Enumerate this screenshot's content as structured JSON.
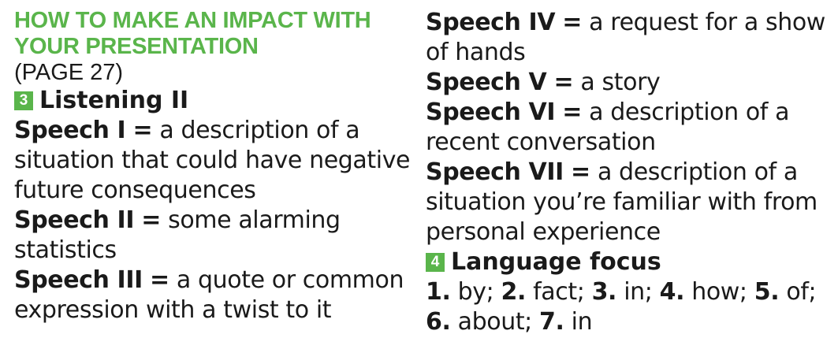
{
  "header": {
    "title": "HOW TO MAKE AN IMPACT WITH YOUR PRESENTATION",
    "page_ref": "(PAGE 27)"
  },
  "sections": {
    "listening": {
      "number": "3",
      "title": "Listening II"
    },
    "language": {
      "number": "4",
      "title": "Language focus"
    }
  },
  "speeches": [
    {
      "label": "Speech I",
      "eq": "=",
      "text": "a description of a situation that could have negative future consequences"
    },
    {
      "label": "Speech II",
      "eq": "=",
      "text": "some alarming statistics"
    },
    {
      "label": "Speech III",
      "eq": "=",
      "text": "a quote or common expression with a twist to it"
    },
    {
      "label": "Speech IV",
      "eq": "=",
      "text": "a request for a show of hands"
    },
    {
      "label": "Speech V",
      "eq": "=",
      "text": "a story"
    },
    {
      "label": "Speech VI",
      "eq": "=",
      "text": "a description of a recent conversation"
    },
    {
      "label": "Speech VII",
      "eq": "=",
      "text": "a description of a situation you’re familiar with from personal experience"
    }
  ],
  "answers": [
    {
      "num": "1.",
      "word": "by;"
    },
    {
      "num": "2.",
      "word": "fact;"
    },
    {
      "num": "3.",
      "word": "in;"
    },
    {
      "num": "4.",
      "word": "how;"
    },
    {
      "num": "5.",
      "word": "of;"
    },
    {
      "num": "6.",
      "word": "about;"
    },
    {
      "num": "7.",
      "word": "in"
    }
  ]
}
